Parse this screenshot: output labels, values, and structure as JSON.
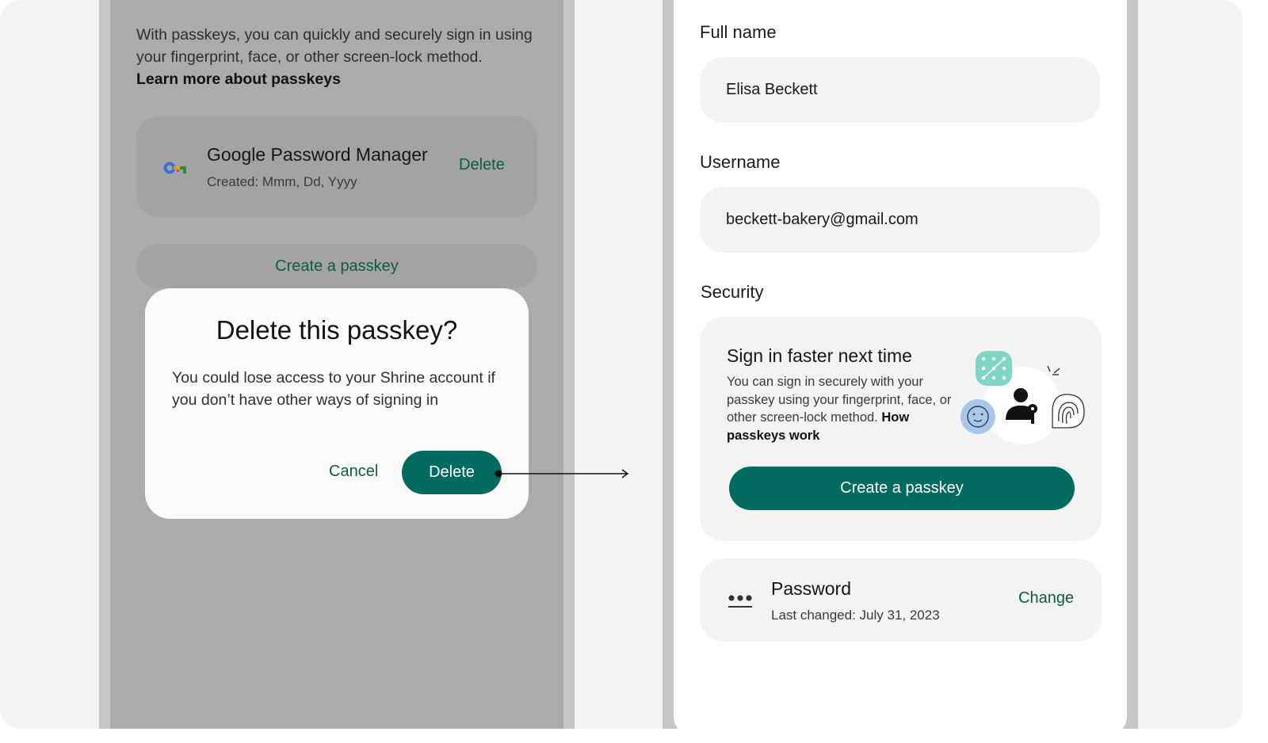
{
  "left_screen": {
    "intro_text": "With passkeys, you can quickly and securely sign in using your fingerprint, face, or other screen-lock method.",
    "learn_more_link": "Learn more about passkeys",
    "credential": {
      "title": "Google Password Manager",
      "created": "Created: Mmm, Dd, Yyyy",
      "delete_label": "Delete",
      "icon": "key-icon"
    },
    "create_button_label": "Create a passkey",
    "dialog": {
      "title": "Delete this passkey?",
      "body": "You could lose access to your Shrine account if you don’t have other ways of signing in",
      "cancel_label": "Cancel",
      "delete_label": "Delete"
    }
  },
  "right_screen": {
    "full_name_label": "Full name",
    "full_name_value": "Elisa Beckett",
    "username_label": "Username",
    "username_value": "beckett-bakery@gmail.com",
    "security_label": "Security",
    "passkey_card": {
      "title": "Sign in faster next time",
      "body": "You can sign in securely with your passkey using your fingerprint, face, or other screen-lock method.",
      "link": "How passkeys work",
      "button_label": "Create a passkey"
    },
    "password_card": {
      "title": "Password",
      "last_changed": "Last changed: July 31, 2023",
      "change_label": "Change",
      "icon": "password-dots-icon"
    }
  },
  "colors": {
    "accent": "#006b5e",
    "accent_text": "#0d5a4d",
    "scrim": "#ababab",
    "card_bg": "#f3f3f3"
  }
}
